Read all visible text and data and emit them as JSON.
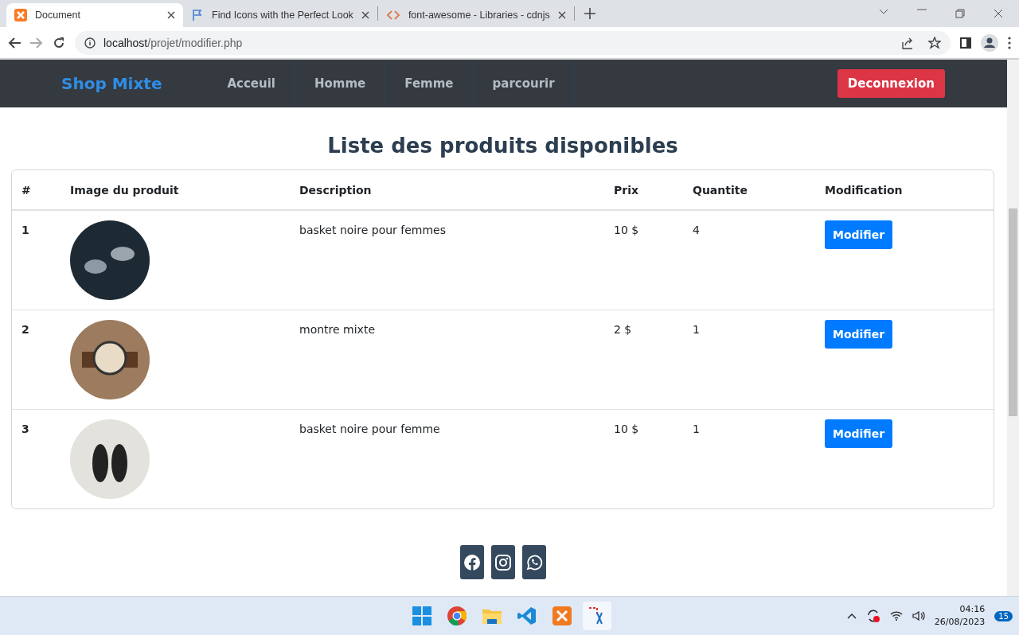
{
  "browser": {
    "tabs": [
      {
        "title": "Document",
        "selected": true
      },
      {
        "title": "Find Icons with the Perfect Look",
        "selected": false
      },
      {
        "title": "font-awesome - Libraries - cdnjs",
        "selected": false
      }
    ],
    "address": {
      "host": "localhost",
      "path": "/projet/modifier.php"
    }
  },
  "navbar": {
    "brand": "Shop Mixte",
    "links": [
      "Acceuil",
      "Homme",
      "Femme",
      "parcourir"
    ],
    "logout": "Deconnexion"
  },
  "page_title": "Liste des produits disponibles",
  "table": {
    "columns": [
      "#",
      "Image du produit",
      "Description",
      "Prix",
      "Quantite",
      "Modification"
    ],
    "rows": [
      {
        "number": "1",
        "description": "basket noire pour femmes",
        "price": "10 $",
        "quantity": "4",
        "action": "Modifier"
      },
      {
        "number": "2",
        "description": "montre mixte",
        "price": "2 $",
        "quantity": "1",
        "action": "Modifier"
      },
      {
        "number": "3",
        "description": "basket noire pour femme",
        "price": "10 $",
        "quantity": "1",
        "action": "Modifier"
      }
    ]
  },
  "taskbar": {
    "time": "04:16",
    "date": "26/08/2023",
    "notifications": "15"
  }
}
